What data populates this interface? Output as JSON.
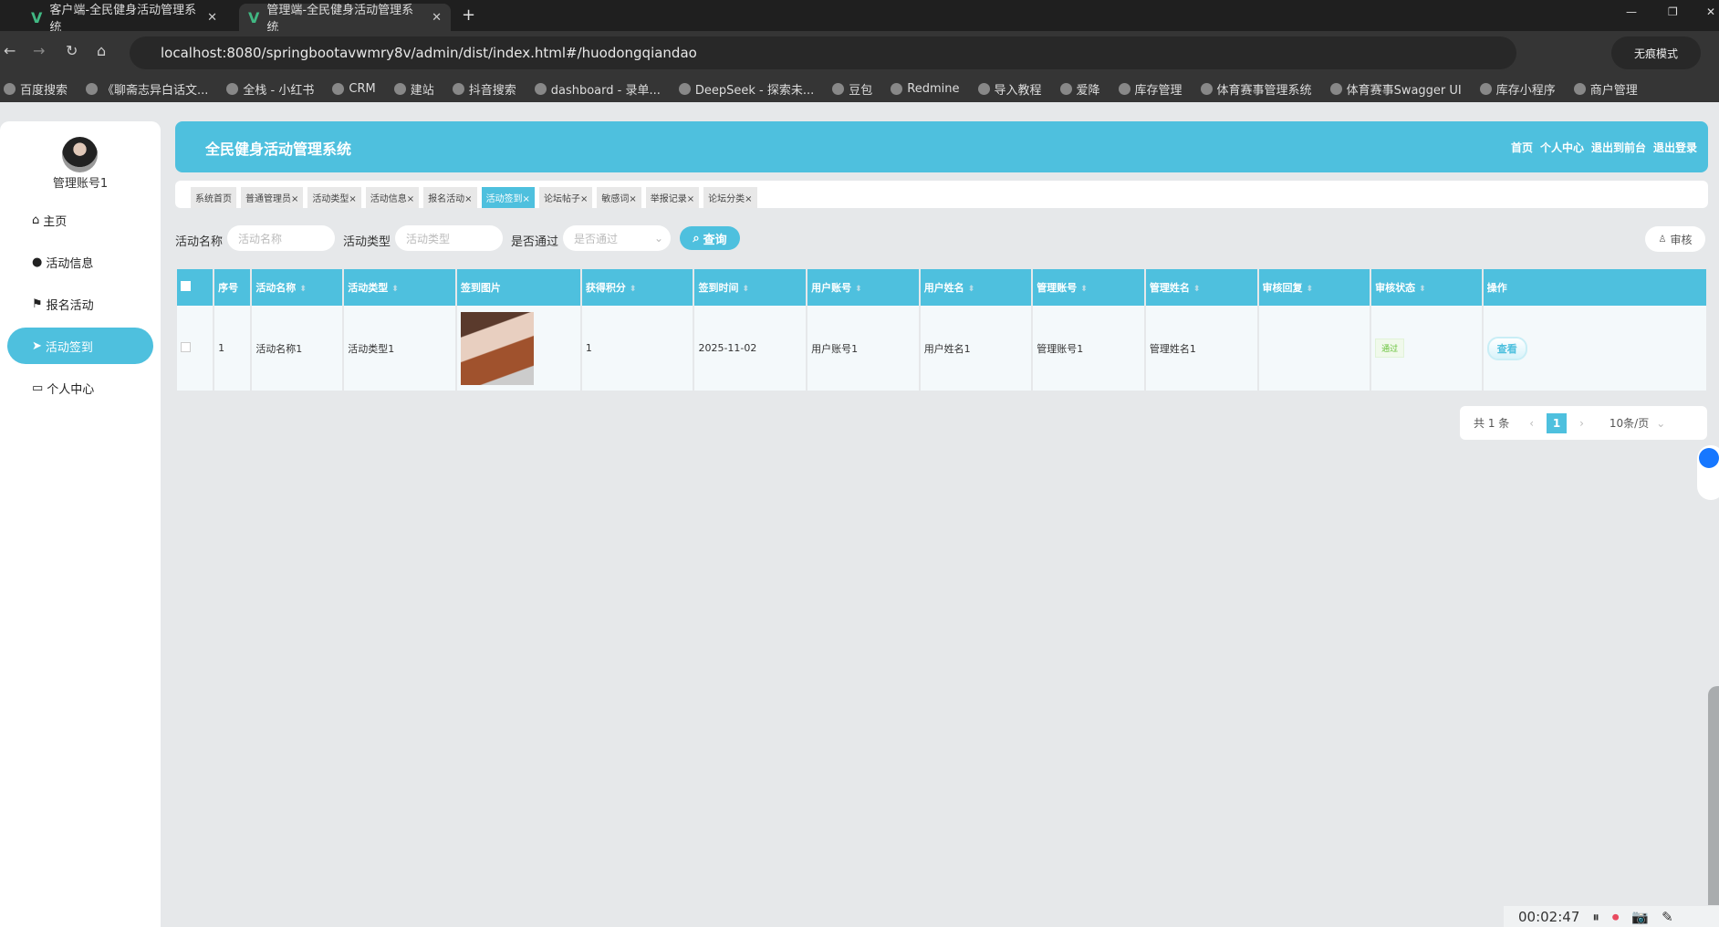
{
  "browser": {
    "tabs": [
      {
        "title": "客户端-全民健身活动管理系统"
      },
      {
        "title": "管理端-全民健身活动管理系统"
      }
    ],
    "url": "localhost:8080/springbootavwmry8v/admin/dist/index.html#/huodongqiandao",
    "incognito": "无痕模式",
    "bookmarks": [
      "百度搜索",
      "《聊斋志异白话文...",
      "全栈 - 小红书",
      "CRM",
      "建站",
      "抖音搜索",
      "dashboard - 录单...",
      "DeepSeek - 探索未...",
      "豆包",
      "Redmine",
      "导入教程",
      "爱降",
      "库存管理",
      "体育赛事管理系统",
      "体育赛事Swagger UI",
      "库存小程序",
      "商户管理"
    ]
  },
  "sidebar": {
    "username": "管理账号1",
    "items": [
      {
        "label": "主页",
        "icon": "home-icon"
      },
      {
        "label": "活动信息",
        "icon": "bulb-icon"
      },
      {
        "label": "报名活动",
        "icon": "flag-icon"
      },
      {
        "label": "活动签到",
        "icon": "send-icon",
        "active": true
      },
      {
        "label": "个人中心",
        "icon": "wallet-icon"
      }
    ]
  },
  "header": {
    "title": "全民健身活动管理系统",
    "links": [
      "首页",
      "个人中心",
      "退出到前台",
      "退出登录"
    ]
  },
  "tags": [
    {
      "label": "系统首页"
    },
    {
      "label": "普通管理员×"
    },
    {
      "label": "活动类型×"
    },
    {
      "label": "活动信息×"
    },
    {
      "label": "报名活动×"
    },
    {
      "label": "活动签到×",
      "active": true
    },
    {
      "label": "论坛帖子×"
    },
    {
      "label": "敏感词×"
    },
    {
      "label": "举报记录×"
    },
    {
      "label": "论坛分类×"
    }
  ],
  "search": {
    "name_label": "活动名称",
    "name_placeholder": "活动名称",
    "type_label": "活动类型",
    "type_placeholder": "活动类型",
    "pass_label": "是否通过",
    "pass_placeholder": "是否通过",
    "query": "查询",
    "audit": "审核"
  },
  "table": {
    "headers": [
      "序号",
      "活动名称",
      "活动类型",
      "签到图片",
      "获得积分",
      "签到时间",
      "用户账号",
      "用户姓名",
      "管理账号",
      "管理姓名",
      "审核回复",
      "审核状态",
      "操作"
    ],
    "rows": [
      {
        "index": "1",
        "name": "活动名称1",
        "type": "活动类型1",
        "points": "1",
        "time": "2025-11-02",
        "user_account": "用户账号1",
        "user_name": "用户姓名1",
        "admin_account": "管理账号1",
        "admin_name": "管理姓名1",
        "reply": "",
        "status": "通过",
        "action": "查看"
      }
    ]
  },
  "pagination": {
    "total": "共 1 条",
    "page": "1",
    "size": "10条/页"
  },
  "recorder": {
    "time": "00:02:47"
  },
  "colors": {
    "accent": "#4ec0de"
  }
}
